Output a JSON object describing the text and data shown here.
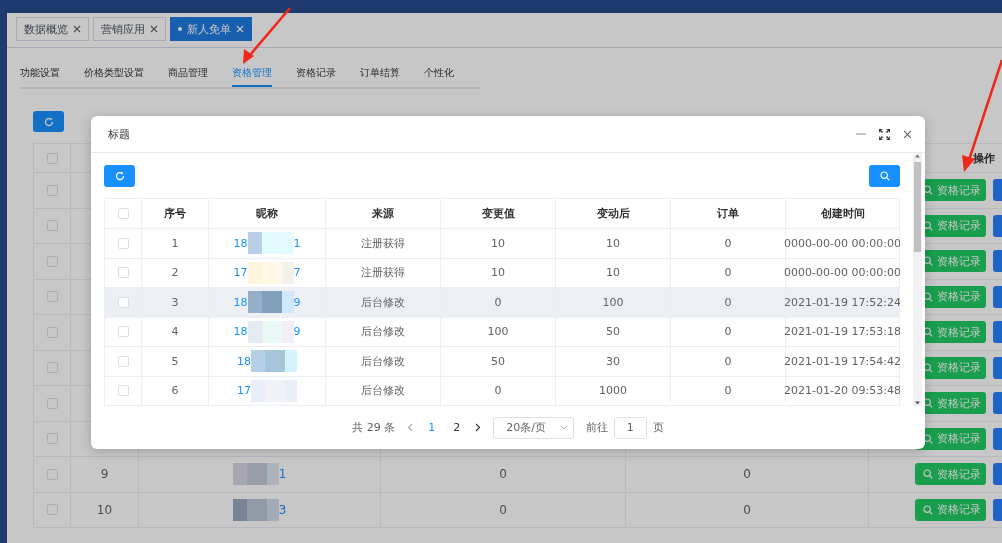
{
  "top_tabs": [
    {
      "label": "数据概览",
      "selected": false
    },
    {
      "label": "营销应用",
      "selected": false
    },
    {
      "label": "新人免单",
      "selected": true
    }
  ],
  "sub_tabs": [
    {
      "label": "功能设置",
      "selected": false
    },
    {
      "label": "价格类型设置",
      "selected": false
    },
    {
      "label": "商品管理",
      "selected": false
    },
    {
      "label": "资格管理",
      "selected": true
    },
    {
      "label": "资格记录",
      "selected": false
    },
    {
      "label": "订单结算",
      "selected": false
    },
    {
      "label": "个性化",
      "selected": false
    }
  ],
  "background_table": {
    "action_header": "操作",
    "header_checked": false,
    "rows": [
      {
        "checked": false,
        "button": "资格记录"
      },
      {
        "checked": false,
        "button": "资格记录"
      },
      {
        "checked": false,
        "button": "资格记录"
      },
      {
        "checked": false,
        "button": "资格记录"
      },
      {
        "checked": false,
        "button": "资格记录"
      },
      {
        "checked": false,
        "button": "资格记录"
      },
      {
        "checked": false,
        "button": "资格记录"
      },
      {
        "checked": false,
        "button": "资格记录"
      },
      {
        "checked": false,
        "seq": "9",
        "nickname": "1",
        "column_4": "0",
        "column_5": "0",
        "button": "资格记录"
      },
      {
        "checked": false,
        "seq": "10",
        "nickname": "3",
        "column_4": "0",
        "column_5": "0",
        "button": "资格记录"
      }
    ]
  },
  "modal": {
    "title": "标题",
    "header_checked": false,
    "columns": [
      "序号",
      "昵称",
      "来源",
      "变更值",
      "变动后",
      "订单",
      "创建时间"
    ],
    "rows": [
      {
        "checked": false,
        "hovered": false,
        "seq": "1",
        "nickname_start": "18",
        "nickname_end": "1",
        "source": "注册获得",
        "change": "10",
        "after": "10",
        "order": "0",
        "created": "0000-00-00 00:00:00"
      },
      {
        "checked": false,
        "hovered": false,
        "seq": "2",
        "nickname_start": "17",
        "nickname_end": "7",
        "source": "注册获得",
        "change": "10",
        "after": "10",
        "order": "0",
        "created": "0000-00-00 00:00:00"
      },
      {
        "checked": false,
        "hovered": true,
        "seq": "3",
        "nickname_start": "18",
        "nickname_end": "9",
        "source": "后台修改",
        "change": "0",
        "after": "100",
        "order": "0",
        "created": "2021-01-19 17:52:24"
      },
      {
        "checked": false,
        "hovered": false,
        "seq": "4",
        "nickname_start": "18",
        "nickname_end": "9",
        "source": "后台修改",
        "change": "100",
        "after": "50",
        "order": "0",
        "created": "2021-01-19 17:53:18"
      },
      {
        "checked": false,
        "hovered": false,
        "seq": "5",
        "nickname_start": "18",
        "source": "后台修改",
        "change": "50",
        "after": "30",
        "order": "0",
        "created": "2021-01-19 17:54:42"
      },
      {
        "checked": false,
        "hovered": false,
        "seq": "6",
        "nickname_start": "17",
        "source": "后台修改",
        "change": "0",
        "after": "1000",
        "order": "0",
        "created": "2021-01-20 09:53:48"
      }
    ],
    "pagination": {
      "total": "共 29 条",
      "pages": [
        {
          "label": "1",
          "selected": true
        },
        {
          "label": "2",
          "selected": false
        }
      ],
      "page_size": "20条/页",
      "goto_label": "前往",
      "goto_value": "1",
      "page_unit": "页"
    }
  }
}
